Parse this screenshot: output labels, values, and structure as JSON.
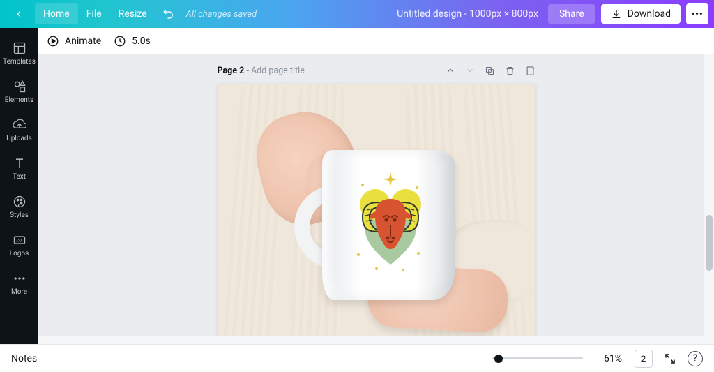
{
  "header": {
    "home": "Home",
    "file": "File",
    "resize": "Resize",
    "status": "All changes saved",
    "doc_title": "Untitled design - 1000px × 800px",
    "share": "Share",
    "download": "Download"
  },
  "sidebar": {
    "items": [
      {
        "label": "Templates"
      },
      {
        "label": "Elements"
      },
      {
        "label": "Uploads"
      },
      {
        "label": "Text"
      },
      {
        "label": "Styles"
      },
      {
        "label": "Logos"
      },
      {
        "label": "More"
      }
    ]
  },
  "toolbar2": {
    "animate": "Animate",
    "duration": "5.0s"
  },
  "page": {
    "label": "Page 2",
    "sep": " - ",
    "placeholder": "Add page title"
  },
  "footer": {
    "notes": "Notes",
    "zoom": "61%",
    "page_count": "2"
  }
}
